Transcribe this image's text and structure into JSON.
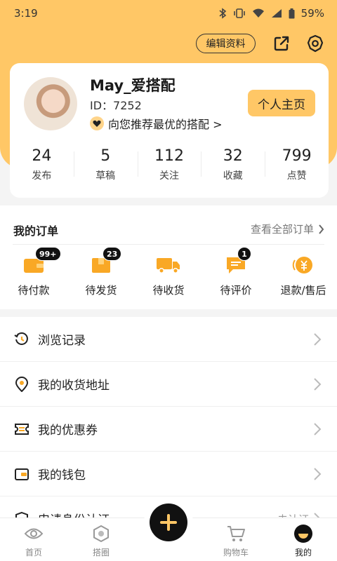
{
  "status_bar": {
    "time": "3:19",
    "battery": "59%"
  },
  "header": {
    "edit_profile_label": "编辑资料",
    "share_icon": "share-icon",
    "settings_icon": "gear-icon"
  },
  "profile": {
    "username": "May_爱搭配",
    "user_id": "ID：7252",
    "recommend_text": "向您推荐最优的搭配 >",
    "homepage_label": "个人主页",
    "stats": [
      {
        "value": "24",
        "label": "发布"
      },
      {
        "value": "5",
        "label": "草稿"
      },
      {
        "value": "112",
        "label": "关注"
      },
      {
        "value": "32",
        "label": "收藏"
      },
      {
        "value": "799",
        "label": "点赞"
      }
    ]
  },
  "orders": {
    "title": "我的订单",
    "view_all": "查看全部订单",
    "items": [
      {
        "label": "待付款",
        "badge": "99+",
        "icon": "wallet-icon"
      },
      {
        "label": "待发货",
        "badge": "23",
        "icon": "package-icon"
      },
      {
        "label": "待收货",
        "badge": "",
        "icon": "truck-icon"
      },
      {
        "label": "待评价",
        "badge": "1",
        "icon": "comment-icon"
      },
      {
        "label": "退款/售后",
        "badge": "",
        "icon": "refund-icon"
      }
    ]
  },
  "menu": [
    {
      "label": "浏览记录",
      "icon": "history-icon"
    },
    {
      "label": "我的收货地址",
      "icon": "location-icon"
    },
    {
      "label": "我的优惠券",
      "icon": "coupon-icon"
    },
    {
      "label": "我的钱包",
      "icon": "wallet-icon"
    },
    {
      "label": "申请身份认证",
      "icon": "shield-icon",
      "extra": "未认证"
    }
  ],
  "bottom_nav": [
    {
      "label": "首页",
      "icon": "eye-icon"
    },
    {
      "label": "搭圈",
      "icon": "hexagon-icon"
    },
    {
      "label": "购物车",
      "icon": "cart-icon"
    },
    {
      "label": "我的",
      "icon": "profile-icon",
      "active": true
    }
  ],
  "colors": {
    "accent": "#ffc766",
    "icon_orange": "#f9a825",
    "dark": "#111111"
  }
}
